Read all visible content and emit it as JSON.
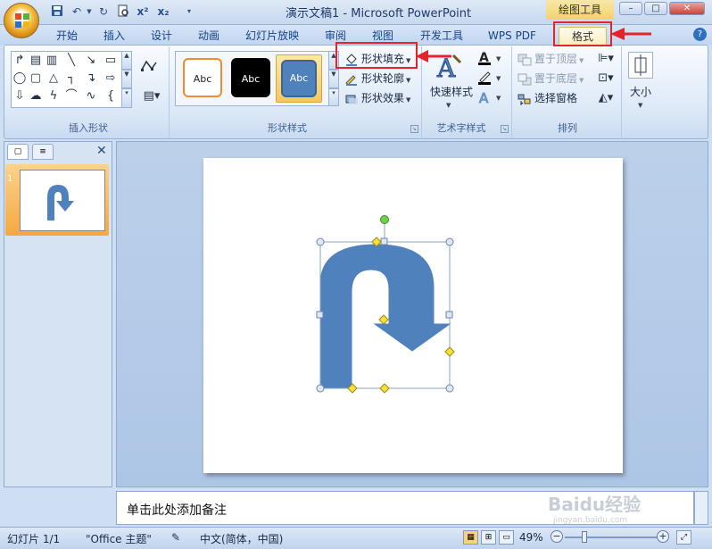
{
  "window": {
    "title": "演示文稿1 - Microsoft PowerPoint",
    "contextual_tab_group": "绘图工具",
    "buttons": {
      "minimize": "–",
      "maximize": "□",
      "close": "✕"
    }
  },
  "quick_access": {
    "icons": [
      "save-icon",
      "undo-icon",
      "redo-icon",
      "print-preview-icon",
      "superscript-icon",
      "subscript-icon",
      "customize-icon"
    ]
  },
  "tabs": [
    {
      "label": "开始"
    },
    {
      "label": "插入"
    },
    {
      "label": "设计"
    },
    {
      "label": "动画"
    },
    {
      "label": "幻灯片放映"
    },
    {
      "label": "审阅"
    },
    {
      "label": "视图"
    },
    {
      "label": "开发工具"
    },
    {
      "label": "WPS PDF"
    },
    {
      "label": "格式",
      "active": true
    }
  ],
  "ribbon": {
    "insert_shapes": {
      "label": "插入形状"
    },
    "shape_styles": {
      "label": "形状样式",
      "gallery": [
        "Abc",
        "Abc",
        "Abc"
      ],
      "fill": "形状填充",
      "outline": "形状轮廓",
      "effects": "形状效果"
    },
    "wordart": {
      "label": "艺术字样式",
      "quick_styles": "快速样式"
    },
    "arrange": {
      "label": "排列",
      "bring_to_front": "置于顶层",
      "send_to_back": "置于底层",
      "selection_pane": "选择窗格"
    },
    "size": {
      "label": "大小"
    }
  },
  "slide_pane": {
    "thumbnail_number": "1"
  },
  "notes": {
    "placeholder": "单击此处添加备注"
  },
  "status": {
    "slide_counter": "幻灯片 1/1",
    "theme": "\"Office 主题\"",
    "language": "中文(简体，中国)",
    "zoom": "49%"
  },
  "colors": {
    "shape_fill": "#4f81bd",
    "annotation_red": "#e5232b",
    "handle_yellow": "#f7e13a",
    "rotation_green": "#6fcf4a"
  },
  "watermark": {
    "text": "Baidu经验",
    "subtext": "jingyan.baidu.com"
  }
}
